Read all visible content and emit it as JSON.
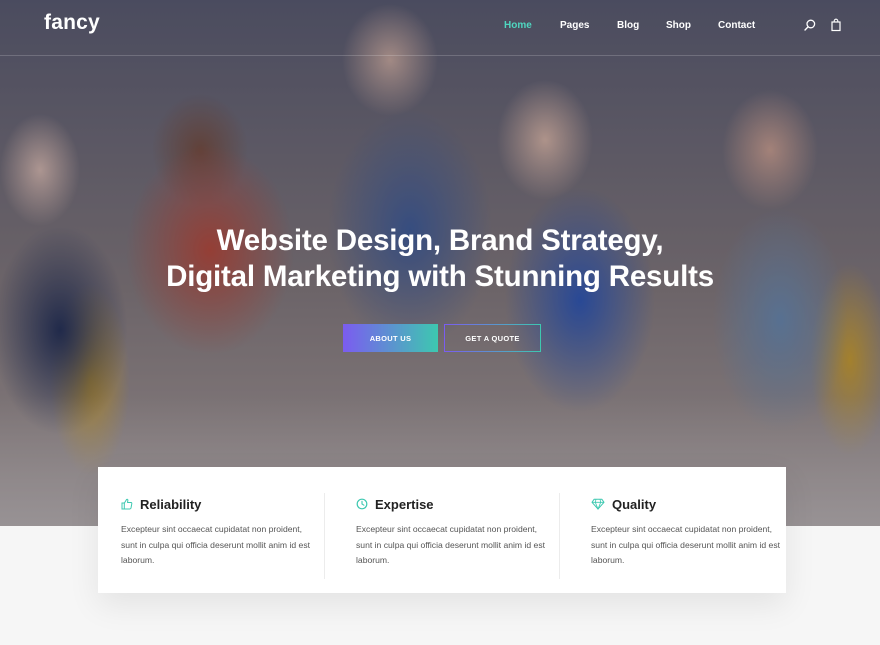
{
  "brand": {
    "logo": "fancy"
  },
  "nav": {
    "items": [
      {
        "label": "Home",
        "active": true
      },
      {
        "label": "Pages",
        "active": false
      },
      {
        "label": "Blog",
        "active": false
      },
      {
        "label": "Shop",
        "active": false
      },
      {
        "label": "Contact",
        "active": false
      }
    ],
    "icons": [
      "search-icon",
      "shopping-bag-icon"
    ],
    "active_color": "#4fd6c0"
  },
  "hero": {
    "headline_line1": "Website Design, Brand Strategy,",
    "headline_line2": "Digital Marketing with Stunning Results",
    "primary_button": "ABOUT US",
    "secondary_button": "GET A QUOTE",
    "gradient_start": "#7b5cf0",
    "gradient_end": "#3dc8b0"
  },
  "features": [
    {
      "title": "Reliability",
      "icon": "thumbs-up-icon",
      "text": "Excepteur sint occaecat cupidatat non proident, sunt in culpa qui officia deserunt mollit anim id est laborum."
    },
    {
      "title": "Expertise",
      "icon": "clock-icon",
      "text": "Excepteur sint occaecat cupidatat non proident, sunt in culpa qui officia deserunt mollit anim id est laborum."
    },
    {
      "title": "Quality",
      "icon": "diamond-icon",
      "text": "Excepteur sint occaecat cupidatat non proident, sunt in culpa qui officia deserunt mollit anim id est laborum."
    }
  ]
}
